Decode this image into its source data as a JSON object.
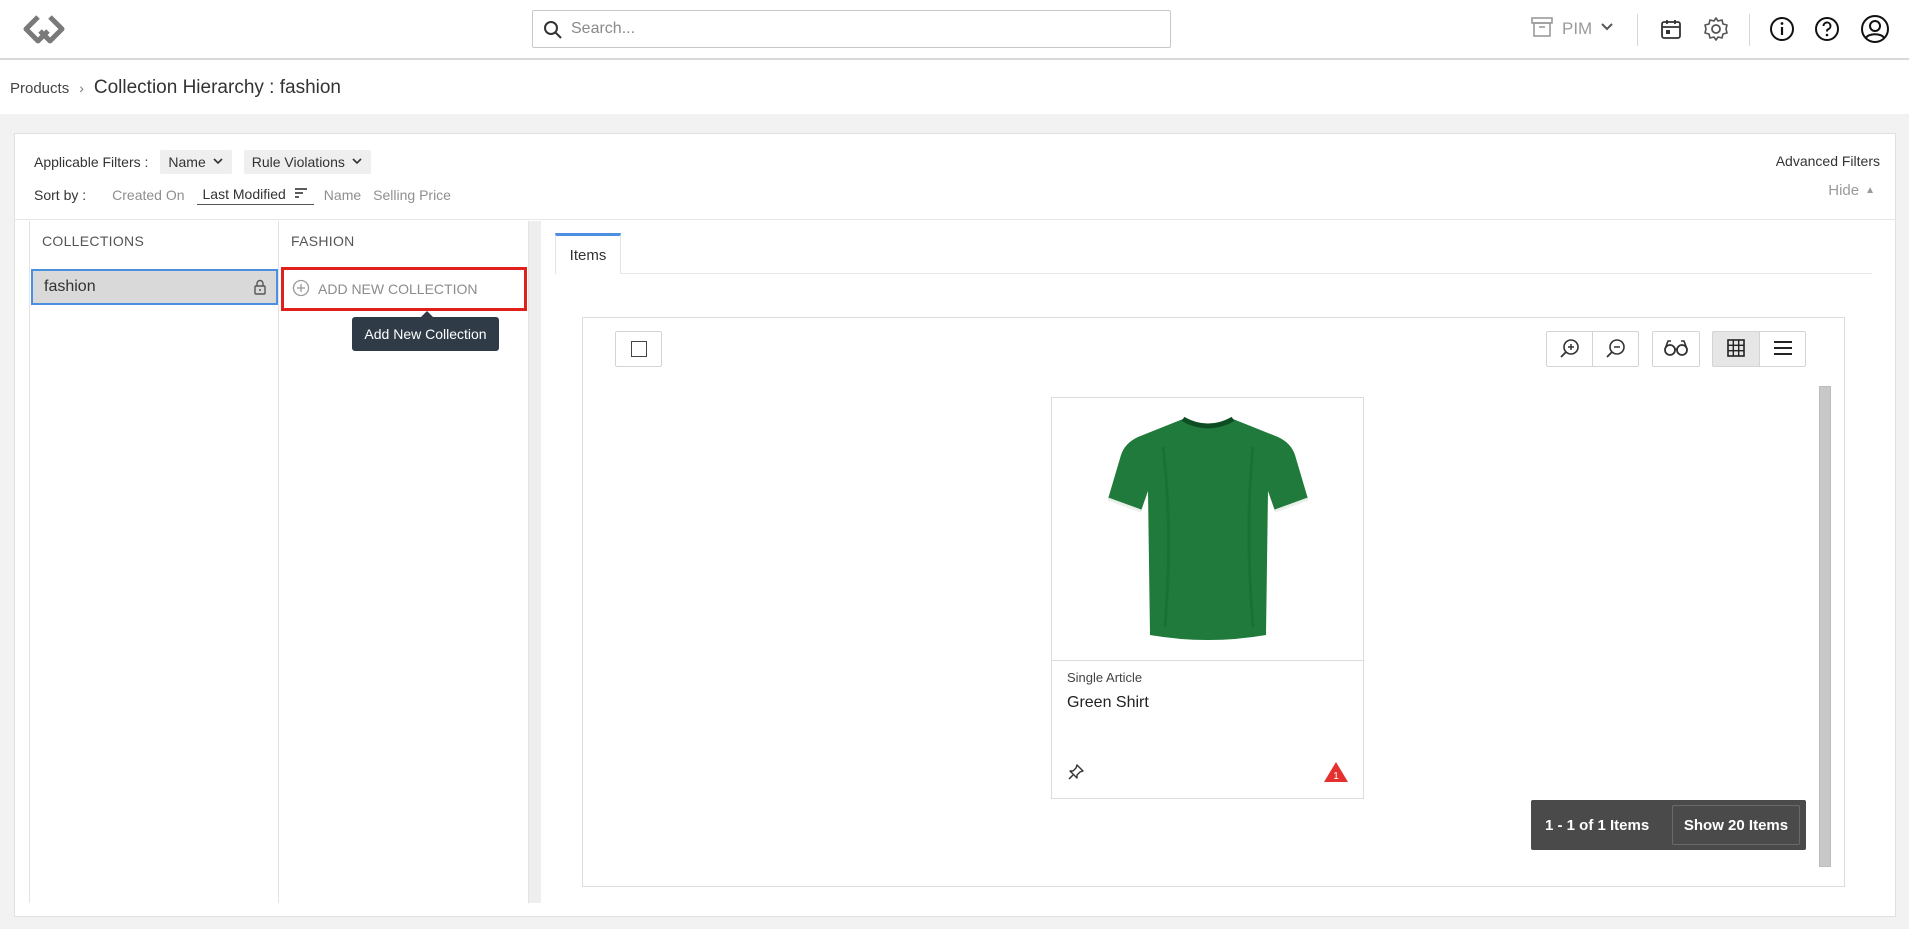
{
  "topbar": {
    "search_placeholder": "Search...",
    "app_switcher_label": "PIM",
    "icons": [
      "logo-icon",
      "search-icon",
      "archive-icon",
      "chevron-down-icon",
      "calendar-icon",
      "gear-icon",
      "info-icon",
      "help-icon",
      "user-icon"
    ]
  },
  "breadcrumb": {
    "root": "Products",
    "separator": "›",
    "current": "Collection Hierarchy : fashion"
  },
  "filters": {
    "label": "Applicable Filters :",
    "chips": [
      "Name",
      "Rule Violations"
    ],
    "advanced": "Advanced Filters"
  },
  "sort": {
    "label": "Sort by :",
    "options": [
      "Created On",
      "Last Modified",
      "Name",
      "Selling Price"
    ],
    "active": "Last Modified",
    "hide_label": "Hide",
    "hide_arrow": "▲"
  },
  "collections_column": {
    "header": "COLLECTIONS",
    "items": [
      {
        "label": "fashion",
        "locked": true
      }
    ]
  },
  "fashion_column": {
    "header": "FASHION",
    "add_label": "ADD NEW COLLECTION",
    "tooltip": "Add New Collection"
  },
  "tabs": [
    {
      "label": "Items",
      "active": true
    }
  ],
  "items": [
    {
      "type": "Single Article",
      "name": "Green Shirt",
      "violations": "1"
    }
  ],
  "pager": {
    "summary": "1 - 1 of 1 Items",
    "show_label": "Show 20 Items"
  },
  "colors": {
    "accent": "#4a8fe0",
    "highlight_border": "#e0201a",
    "warning": "#e53030",
    "shirt": "#1f7a3c"
  }
}
